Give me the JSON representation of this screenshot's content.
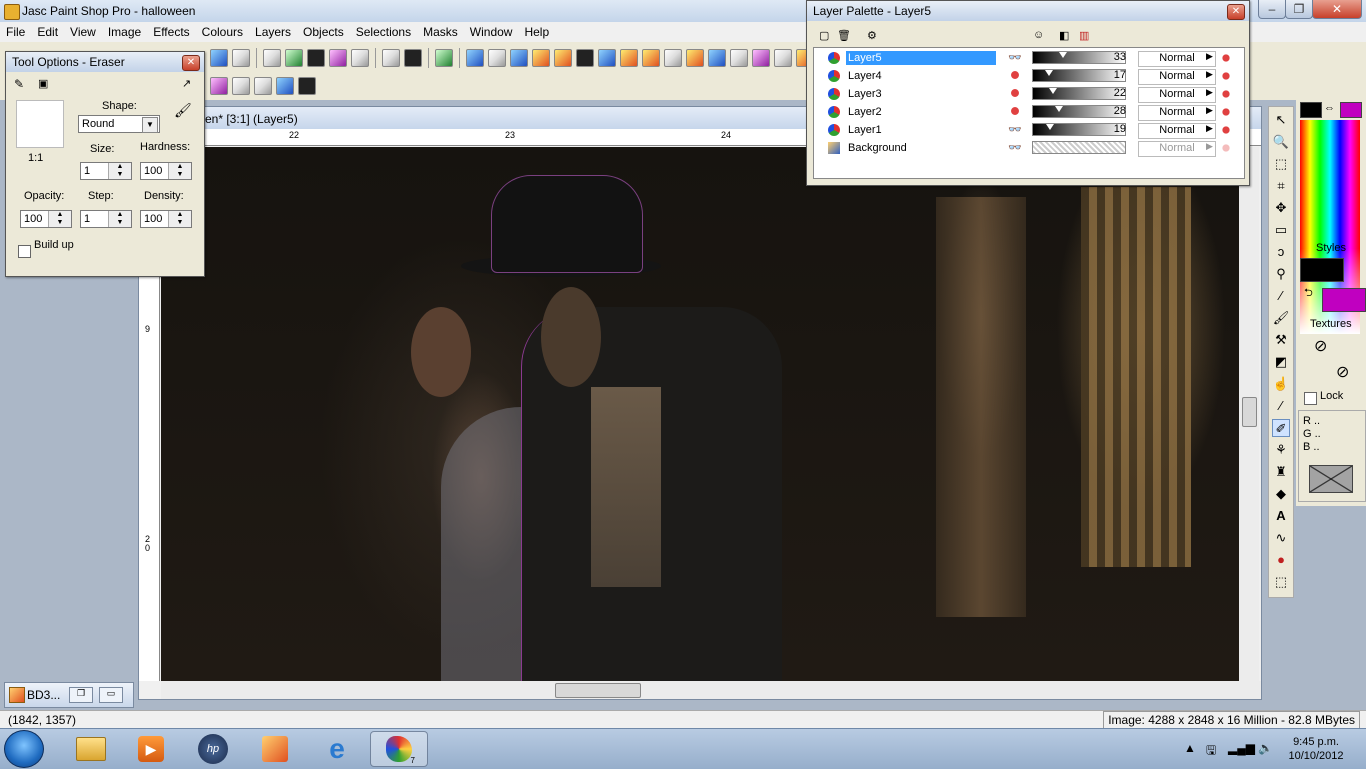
{
  "app": {
    "title": "Jasc Paint Shop Pro - halloween",
    "window_buttons": [
      "–",
      "❐",
      "✕"
    ]
  },
  "menu": [
    "File",
    "Edit",
    "View",
    "Image",
    "Effects",
    "Colours",
    "Layers",
    "Objects",
    "Selections",
    "Masks",
    "Window",
    "Help"
  ],
  "image_window": {
    "title": "en* [3:1] (Layer5)",
    "ruler_top": [
      "22",
      "23",
      "24"
    ],
    "ruler_left": [
      "1",
      "9",
      "2 0"
    ]
  },
  "tool_options": {
    "title": "Tool Options - Eraser",
    "preview_ratio": "1:1",
    "shape_label": "Shape:",
    "shape_value": "Round",
    "size_label": "Size:",
    "size_value": "1",
    "hardness_label": "Hardness:",
    "hardness_value": "100",
    "opacity_label": "Opacity:",
    "opacity_value": "100",
    "step_label": "Step:",
    "step_value": "1",
    "density_label": "Density:",
    "density_value": "100",
    "buildup_label": "Build up",
    "close": "✕"
  },
  "layer_palette": {
    "title": "Layer Palette - Layer5",
    "close": "✕",
    "layers": [
      {
        "name": "Layer5",
        "opacity": "33",
        "blend": "Normal",
        "selected": true
      },
      {
        "name": "Layer4",
        "opacity": "17",
        "blend": "Normal",
        "selected": false
      },
      {
        "name": "Layer3",
        "opacity": "22",
        "blend": "Normal",
        "selected": false
      },
      {
        "name": "Layer2",
        "opacity": "28",
        "blend": "Normal",
        "selected": false
      },
      {
        "name": "Layer1",
        "opacity": "19",
        "blend": "Normal",
        "selected": false
      },
      {
        "name": "Background",
        "opacity": "",
        "blend": "Normal",
        "selected": false
      }
    ]
  },
  "colour_palette": {
    "styles_label": "Styles",
    "textures_label": "Textures",
    "lock_label": "Lock",
    "rgb": [
      "R ..",
      "G ..",
      "B .."
    ],
    "foreground": "#000000",
    "background": "#c000c0"
  },
  "minimized_doc": {
    "title": "BD3..."
  },
  "status": {
    "coords": "(1842, 1357)",
    "image_info": "Image:  4288 x 2848 x 16 Million - 82.8 MBytes"
  },
  "taskbar": {
    "time": "9:45 p.m.",
    "date": "10/10/2012",
    "psp_badge": "7"
  }
}
